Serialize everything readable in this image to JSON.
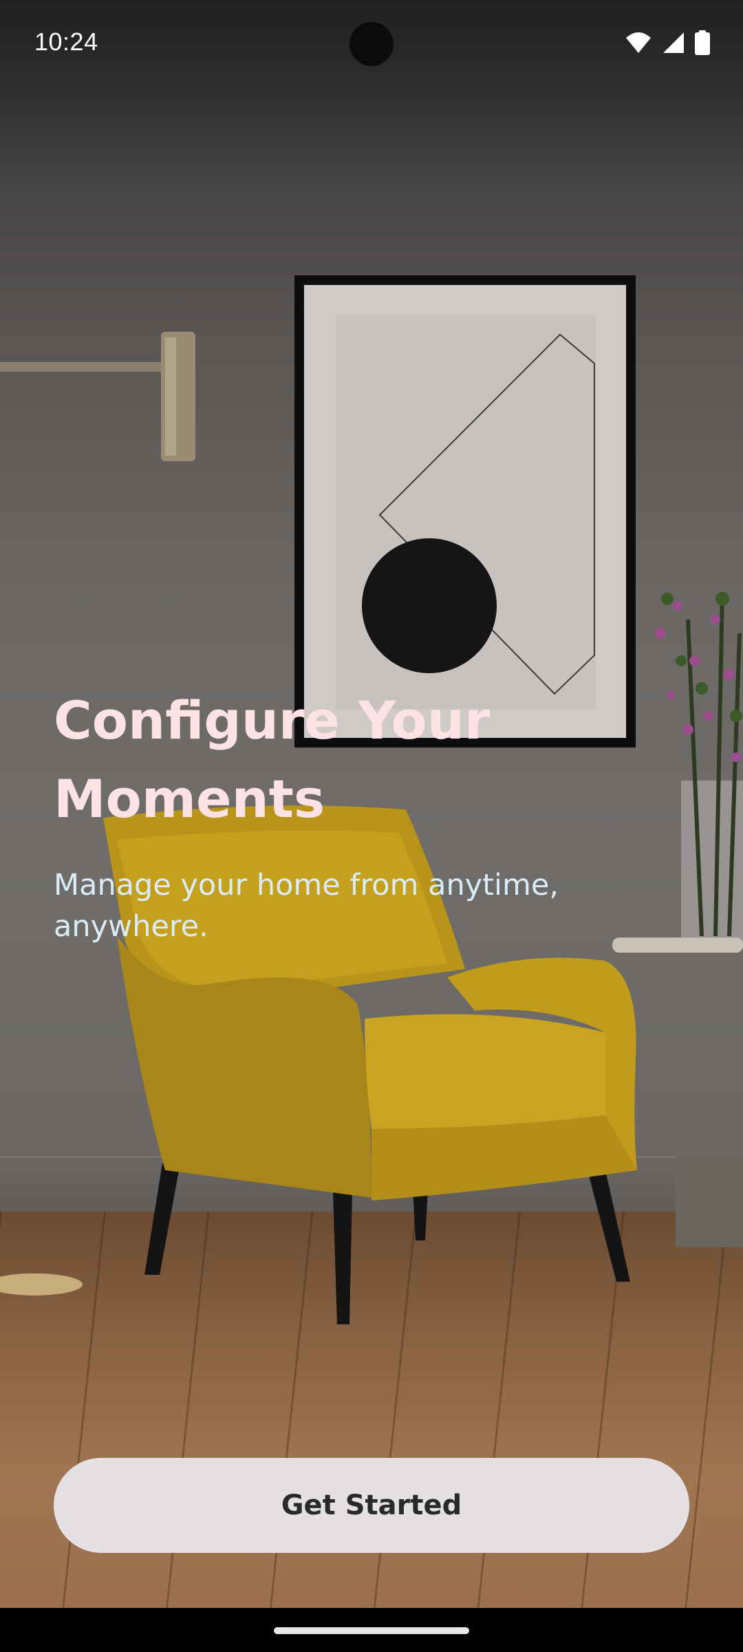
{
  "status_bar": {
    "time": "10:24",
    "icons": [
      "wifi-icon",
      "cellular-signal-icon",
      "battery-icon"
    ]
  },
  "hero": {
    "headline": "Configure Your Moments",
    "subheadline": "Manage your home from anytime, anywhere."
  },
  "actions": {
    "primary_label": "Get Started"
  },
  "colors": {
    "headline": "#fde2e3",
    "subheadline": "#d9ecf7",
    "button_bg": "#e4e0e4",
    "button_text": "#2a2a2c",
    "chair": "#c9a21a"
  }
}
